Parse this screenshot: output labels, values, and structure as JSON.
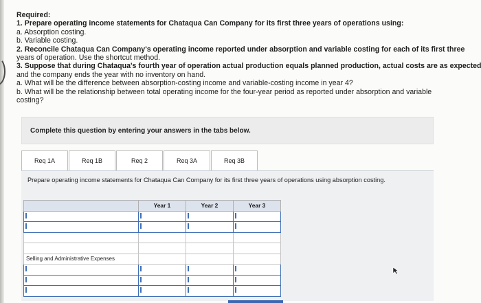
{
  "required": {
    "heading": "Required:",
    "lines": [
      "1. Prepare operating income statements for Chataqua Can Company for its first three years of operations using:",
      "a. Absorption costing.",
      "b. Variable costing.",
      "2. Reconcile Chataqua Can Company's operating income reported under absorption and variable costing for each of its first three",
      "years of operation. Use the shortcut method.",
      "3. Suppose that during Chataqua's fourth year of operation actual production equals planned production, actual costs are as expected,",
      "and the company ends the year with no inventory on hand.",
      "a. What will be the difference between absorption-costing income and variable-costing income in year 4?",
      "b. What will be the relationship between total operating income for the four-year period as reported under absorption and variable",
      "costing?"
    ]
  },
  "panel": {
    "text": "Complete this question by entering your answers in the tabs below."
  },
  "tabs": [
    "Req 1A",
    "Req 1B",
    "Req 2",
    "Req 3A",
    "Req 3B"
  ],
  "instruction": "Prepare operating income statements for Chataqua Can Company for its first three years of operations using absorption costing.",
  "table": {
    "headers": [
      "",
      "Year 1",
      "Year 2",
      "Year 3"
    ],
    "row_label": "Selling and Administrative Expenses"
  },
  "colors": {
    "accent": "#3f6fb5",
    "header_bg": "#dde3ec",
    "panel_bg": "#ececec"
  }
}
